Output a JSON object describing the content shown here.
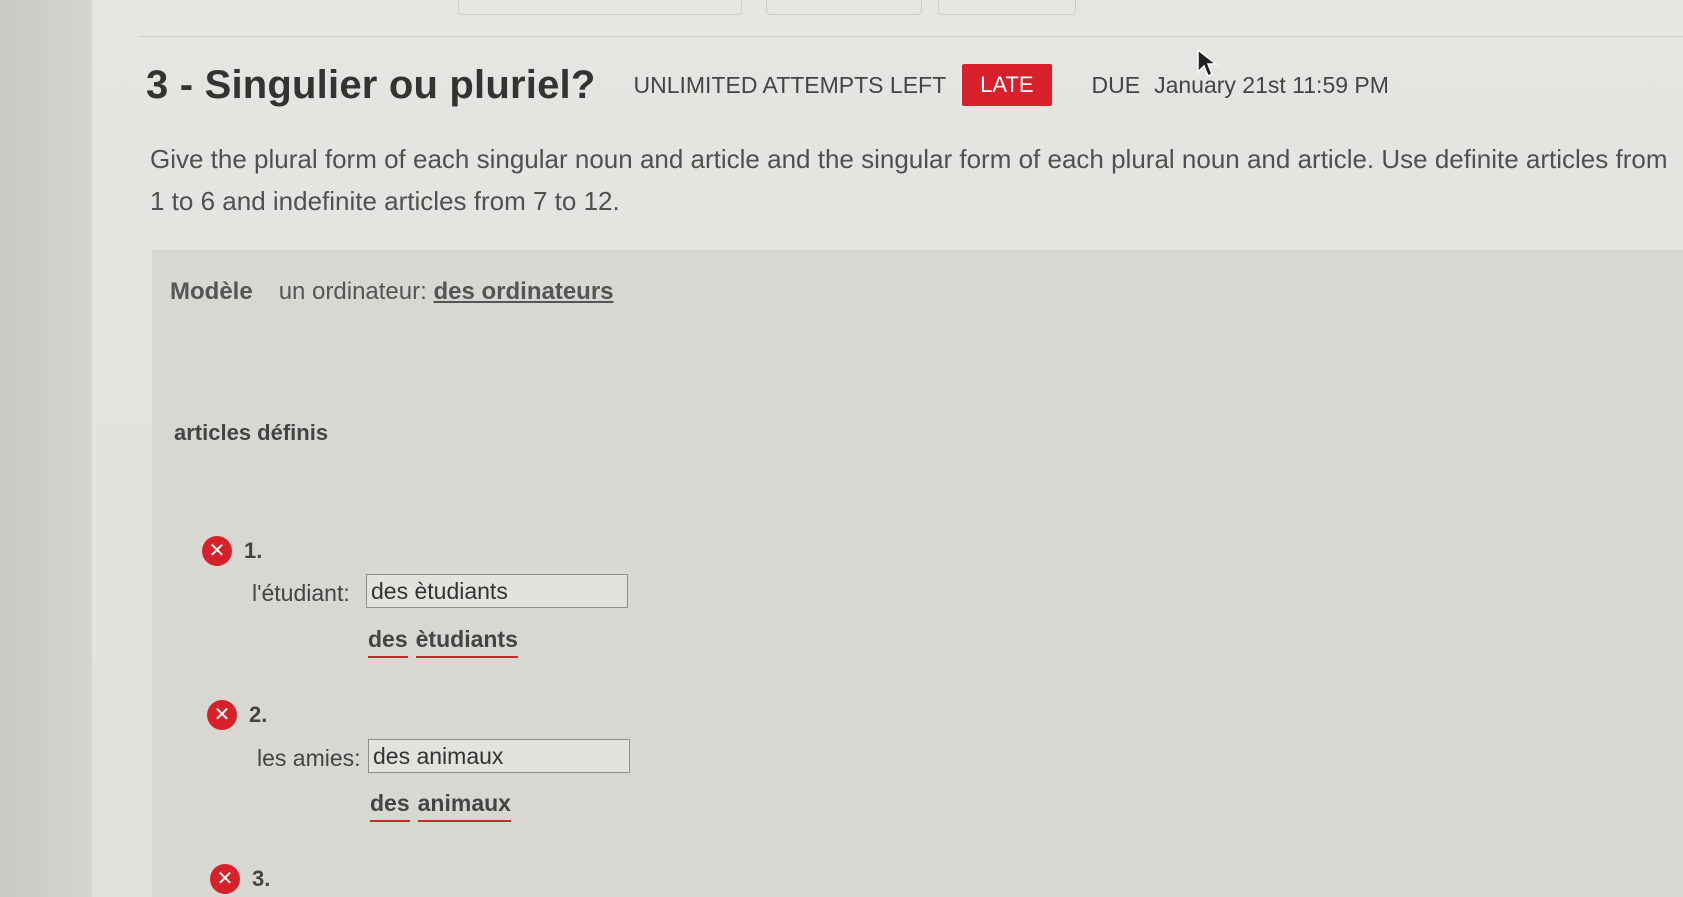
{
  "header": {
    "title": "3 - Singulier ou pluriel?",
    "attempts": "UNLIMITED ATTEMPTS LEFT",
    "late_badge": "LATE",
    "due_label": "DUE",
    "due_date": "January 21st 11:59 PM"
  },
  "instructions": "Give the plural form of each singular noun and article and the singular form of each plural noun and article. Use definite articles from 1 to 6 and indefinite articles from 7 to 12.",
  "model": {
    "label": "Modèle",
    "prompt": "un ordinateur:",
    "answer": "des ordinateurs"
  },
  "section_title": "articles définis",
  "questions": [
    {
      "number": "1.",
      "prompt": "l'étudiant:",
      "value": "des ètudiants",
      "correct_words": [
        "des",
        "ètudiants"
      ]
    },
    {
      "number": "2.",
      "prompt": "les amies:",
      "value": "des animaux",
      "correct_words": [
        "des",
        "animaux"
      ]
    },
    {
      "number": "3."
    }
  ],
  "colors": {
    "late": "#d8202a",
    "error_icon": "#d8202a",
    "underline": "#c32a2a"
  },
  "icons": {
    "wrong": "x-circle-icon",
    "cursor": "mouse-pointer-icon"
  }
}
